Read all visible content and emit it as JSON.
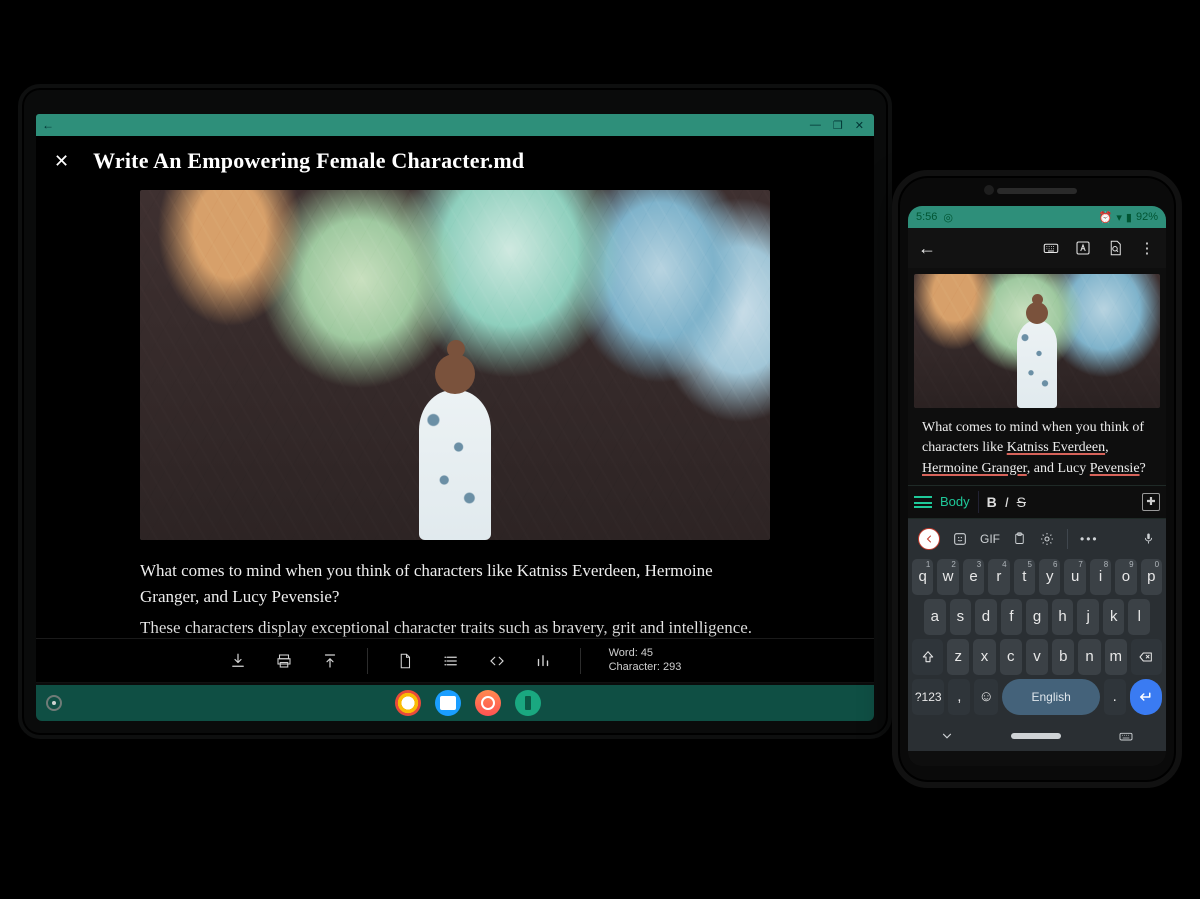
{
  "laptop": {
    "title": "Write An Empowering Female Character.md",
    "paragraph1": "What comes to mind when you think of characters like Katniss Everdeen, Hermoine Granger, and Lucy Pevensie?",
    "paragraph2": "These characters display exceptional character traits such as bravery, grit and intelligence. They are empowering women in their own right, and have captured the hearts of many readers.",
    "stats": {
      "word_label": "Word:",
      "word_count": "45",
      "char_label": "Character:",
      "char_count": "293"
    }
  },
  "phone": {
    "status": {
      "time": "5:56",
      "battery": "92%"
    },
    "text": {
      "prefix": "What comes to mind when you think of characters like ",
      "u1": "Katniss Everdeen",
      "mid1": ", ",
      "u2": "Hermoine Granger",
      "mid2": ", and Lucy ",
      "u3": "Pevensie",
      "suffix": "?"
    },
    "format": {
      "body_label": "Body",
      "bold": "B",
      "italic": "I",
      "strike": "S"
    },
    "keyboard": {
      "gif_label": "GIF",
      "row1_keys": [
        "q",
        "w",
        "e",
        "r",
        "t",
        "y",
        "u",
        "i",
        "o",
        "p"
      ],
      "row1_nums": [
        "1",
        "2",
        "3",
        "4",
        "5",
        "6",
        "7",
        "8",
        "9",
        "0"
      ],
      "row2_keys": [
        "a",
        "s",
        "d",
        "f",
        "g",
        "h",
        "j",
        "k",
        "l"
      ],
      "row3_keys": [
        "z",
        "x",
        "c",
        "v",
        "b",
        "n",
        "m"
      ],
      "mode_label": "?123",
      "comma": ",",
      "space_label": "English",
      "period": "."
    }
  }
}
